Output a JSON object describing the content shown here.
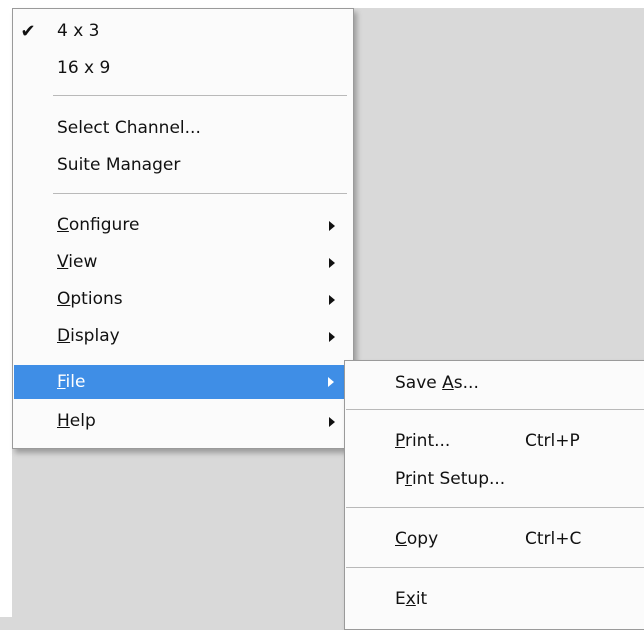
{
  "main_menu": {
    "aspect_items": [
      {
        "label": "4 x 3",
        "checked": true,
        "check_glyph": "✔"
      },
      {
        "label": "16 x 9",
        "checked": false
      }
    ],
    "tool_items": [
      {
        "label": "Select Channel..."
      },
      {
        "label": "Suite Manager"
      }
    ],
    "submenu_items": [
      {
        "mnemonic": "C",
        "rest": "onfigure"
      },
      {
        "mnemonic": "V",
        "rest": "iew"
      },
      {
        "mnemonic": "O",
        "rest": "ptions"
      },
      {
        "mnemonic": "D",
        "rest": "isplay"
      },
      {
        "mnemonic": "F",
        "rest": "ile",
        "highlighted": true
      },
      {
        "mnemonic": "H",
        "rest": "elp"
      }
    ]
  },
  "file_menu": {
    "save_as": {
      "pre": "Save ",
      "mnemonic": "A",
      "post": "s..."
    },
    "print": {
      "pre": "",
      "mnemonic": "P",
      "post": "rint...",
      "shortcut": "Ctrl+P"
    },
    "print_setup": {
      "pre": "P",
      "mnemonic": "r",
      "post": "int Setup..."
    },
    "copy": {
      "pre": "",
      "mnemonic": "C",
      "post": "opy",
      "shortcut": "Ctrl+C"
    },
    "exit": {
      "pre": "E",
      "mnemonic": "x",
      "post": "it"
    }
  },
  "colors": {
    "highlight": "#3f8ee6",
    "menu_bg": "#fbfbfb",
    "desktop_bg": "#d9d9d9"
  },
  "icons": {
    "check": "checkmark-icon",
    "submenu_arrow": "submenu-arrow-icon"
  }
}
